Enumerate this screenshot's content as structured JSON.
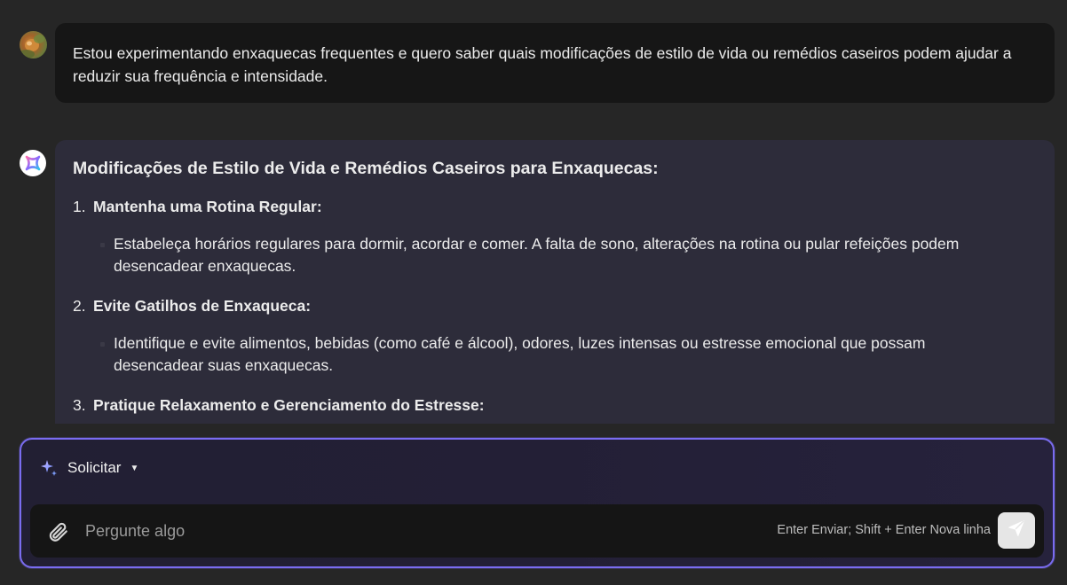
{
  "user_message": {
    "text": "Estou experimentando enxaquecas frequentes e quero saber quais modificações de estilo de vida ou remédios caseiros podem ajudar a reduzir sua frequência e intensidade."
  },
  "assistant_message": {
    "title": "Modificações de Estilo de Vida e Remédios Caseiros para Enxaquecas:",
    "items": [
      {
        "number": "1.",
        "heading": "Mantenha uma Rotina Regular:",
        "bullet": "Estabeleça horários regulares para dormir, acordar e comer. A falta de sono, alterações na rotina ou pular refeições podem desencadear enxaquecas."
      },
      {
        "number": "2.",
        "heading": "Evite Gatilhos de Enxaqueca:",
        "bullet": "Identifique e evite alimentos, bebidas (como café e álcool), odores, luzes intensas ou estresse emocional que possam desencadear suas enxaquecas."
      },
      {
        "number": "3.",
        "heading": "Pratique Relaxamento e Gerenciamento do Estresse:"
      }
    ]
  },
  "composer": {
    "mode_label": "Solicitar",
    "placeholder": "Pergunte algo",
    "hint": "Enter Enviar; Shift + Enter Nova linha"
  },
  "icons": {
    "mode": "sparkle-icon",
    "mode_dropdown": "caret-down-icon",
    "attach": "paperclip-icon",
    "send": "send-icon",
    "assistant_avatar": "assistant-logo-icon",
    "user_avatar": "user-avatar"
  },
  "colors": {
    "background": "#262626",
    "user_bubble": "#161616",
    "assistant_bubble": "#2d2c3a",
    "composer_border": "#7a6cf0",
    "send_button": "#e6e6e6"
  }
}
